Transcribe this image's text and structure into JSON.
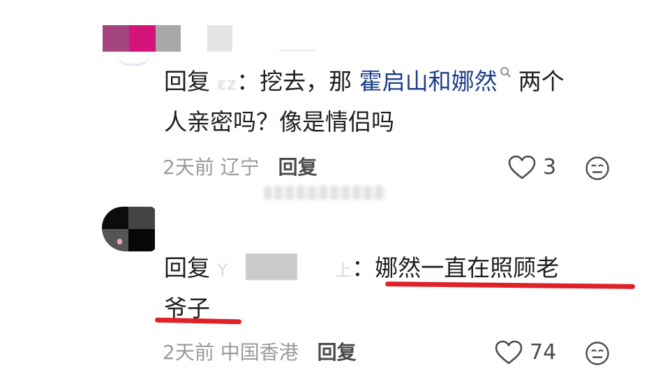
{
  "comment1": {
    "reply_prefix": "回复",
    "blurred_username": "ɛz",
    "separator": "：",
    "text_before_link": "挖去，那 ",
    "linked_names": "霍启山和娜然",
    "text_after_link": "两个",
    "line2": "人亲密吗？像是情侣吗",
    "time": "2天前",
    "location": "辽宁",
    "reply_label": "回复",
    "like_count": "3"
  },
  "comment2": {
    "reply_prefix": "回复",
    "blurred_username_start": "Y",
    "blurred_username_end": "上",
    "separator": "：",
    "text_line1": "娜然一直在照顾老",
    "text_line2": "爷子",
    "time": "2天前",
    "location": "中国香港",
    "reply_label": "回复",
    "like_count": "74"
  },
  "icons": {
    "like": "heart-outline-icon",
    "emoji": "neutral-face-icon",
    "search": "search-icon"
  },
  "colors": {
    "link": "#1e3f8a",
    "highlight_underline": "#df2128",
    "meta_text": "#9a9a9a"
  }
}
